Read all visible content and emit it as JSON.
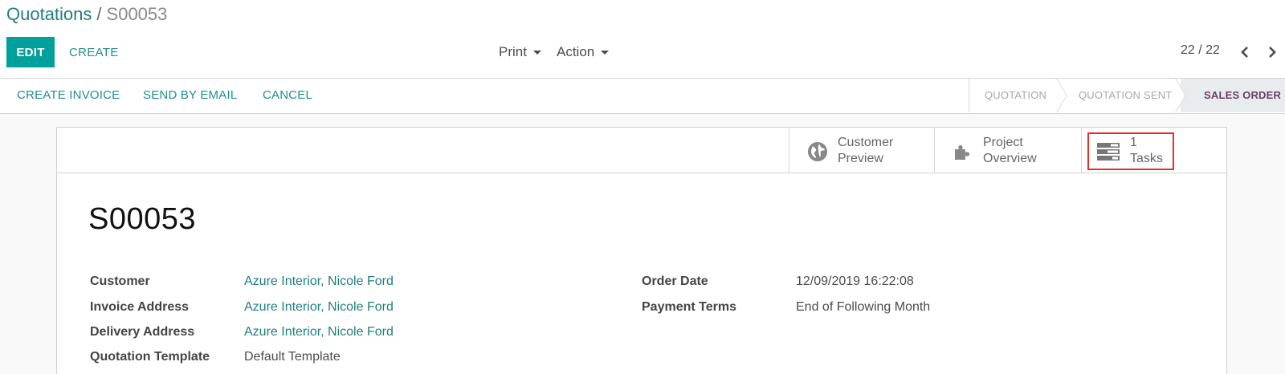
{
  "breadcrumb": {
    "parent": "Quotations",
    "separator": "/",
    "current": "S00053"
  },
  "toolbar": {
    "edit_label": "EDIT",
    "create_label": "CREATE",
    "print_label": "Print",
    "action_label": "Action"
  },
  "pager": {
    "value": "22 / 22",
    "prev_icon": "chevron-left-icon",
    "next_icon": "chevron-right-icon"
  },
  "statusbar": {
    "buttons": [
      "CREATE INVOICE",
      "SEND BY EMAIL",
      "CANCEL"
    ],
    "stages": [
      "QUOTATION",
      "QUOTATION SENT",
      "SALES ORDER"
    ],
    "active_stage": "SALES ORDER"
  },
  "smart_buttons": [
    {
      "icon": "globe-icon",
      "line1": "Customer",
      "line2": "Preview"
    },
    {
      "icon": "puzzle-icon",
      "line1": "Project",
      "line2": "Overview"
    },
    {
      "icon": "tasks-icon",
      "line1": "1",
      "line2": "Tasks"
    }
  ],
  "record": {
    "name": "S00053",
    "left_fields": [
      {
        "label": "Customer",
        "value": "Azure Interior, Nicole Ford"
      },
      {
        "label": "Invoice Address",
        "value": "Azure Interior, Nicole Ford"
      },
      {
        "label": "Delivery Address",
        "value": "Azure Interior, Nicole Ford"
      },
      {
        "label": "Quotation Template",
        "value": "Default Template"
      }
    ],
    "right_fields": [
      {
        "label": "Order Date",
        "value": "12/09/2019 16:22:08"
      },
      {
        "label": "Payment Terms",
        "value": "End of Following Month"
      }
    ]
  },
  "colors": {
    "brand": "#00a09d",
    "link": "#1f7f7c",
    "active_stage": "#6c3f63",
    "highlight": "#e03030"
  }
}
